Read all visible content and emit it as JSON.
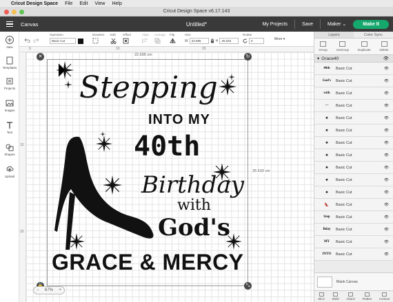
{
  "mac_menu": {
    "apple": "",
    "app_name": "Cricut Design Space",
    "file": "File",
    "edit": "Edit",
    "view": "View",
    "help": "Help"
  },
  "window": {
    "title": "Cricut Design Space  v6.17.143"
  },
  "header": {
    "canvas_label": "Canvas",
    "doc_title": "Untitled*",
    "my_projects": "My Projects",
    "save": "Save",
    "machine": "Maker",
    "make_it": "Make It",
    "accent_color": "#15a86c"
  },
  "toolbar": {
    "operation_label": "Operation",
    "operation_value": "Basic Cut",
    "deselect": "Deselect",
    "edit": "Edit",
    "offset": "Offset",
    "align": "Align",
    "arrange": "Arrange",
    "flip": "Flip",
    "size_label": "Size",
    "width_prefix": "W",
    "width_value": "22.695",
    "height_prefix": "H",
    "height_value": "25.633",
    "rotate_label": "Rotate",
    "rotate_value": "0",
    "more": "More"
  },
  "leftbar": {
    "new": "New",
    "templates": "Templates",
    "projects": "Projects",
    "images": "Images",
    "text": "Text",
    "shapes": "Shapes",
    "upload": "Upload"
  },
  "canvas": {
    "ruler_top": [
      "0",
      "10",
      "20"
    ],
    "ruler_left": [
      "10",
      "20"
    ],
    "width_dim": "22.695 cm",
    "height_dim": "25.633 cm",
    "zoom": "67%",
    "design": {
      "line1": "Stepping",
      "line2": "INTO MY",
      "line3": "40th",
      "line4": "Birthday",
      "line5": "with",
      "line6": "God's",
      "line7": "GRACE & MERCY"
    }
  },
  "rightpanel": {
    "tab_layers": "Layers",
    "tab_color_sync": "Color Sync",
    "tools": [
      "Group",
      "UnGroup",
      "Duplicate",
      "Delete"
    ],
    "group_name": "Grace40",
    "layers": [
      {
        "thumb": "40th",
        "name": "Basic Cut"
      },
      {
        "thumb": "God's",
        "name": "Basic Cut"
      },
      {
        "thumb": "with",
        "name": "Basic Cut"
      },
      {
        "thumb": "—",
        "name": "Basic Cut"
      },
      {
        "thumb": "✷",
        "name": "Basic Cut"
      },
      {
        "thumb": "✷",
        "name": "Basic Cut"
      },
      {
        "thumb": "✷",
        "name": "Basic Cut"
      },
      {
        "thumb": "✷",
        "name": "Basic Cut"
      },
      {
        "thumb": "✷",
        "name": "Basic Cut"
      },
      {
        "thumb": "✷",
        "name": "Basic Cut"
      },
      {
        "thumb": "✷",
        "name": "Basic Cut"
      },
      {
        "thumb": "👠",
        "name": "Basic Cut"
      },
      {
        "thumb": "Step",
        "name": "Basic Cut"
      },
      {
        "thumb": "Bday",
        "name": "Basic Cut"
      },
      {
        "thumb": "MY",
        "name": "Basic Cut"
      },
      {
        "thumb": "INTO",
        "name": "Basic Cut"
      }
    ],
    "blank_canvas": "Blank Canvas",
    "bottom_tools": [
      "Slice",
      "Weld",
      "Attach",
      "Flatten",
      "Contour"
    ]
  }
}
